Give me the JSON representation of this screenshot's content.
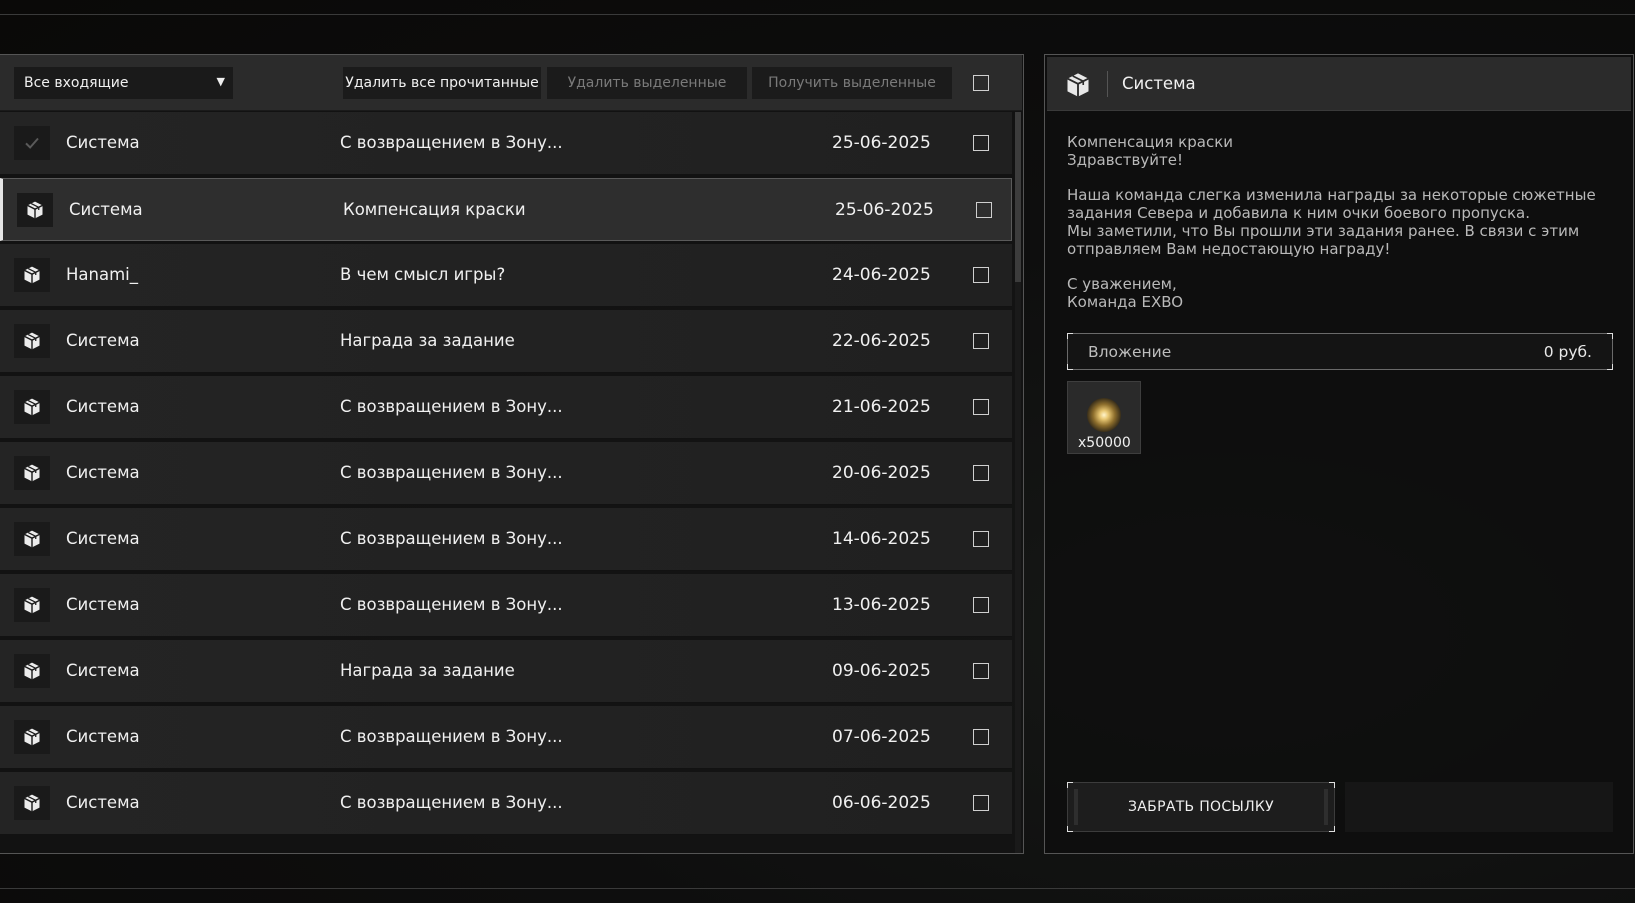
{
  "toolbar": {
    "filter_selected": "Все входящие",
    "delete_read_label": "Удалить все прочитанные",
    "delete_selected_label": "Удалить выделенные",
    "receive_selected_label": "Получить выделенные"
  },
  "mail_list": [
    {
      "sender": "Система",
      "subject": "С возвращением в Зону...",
      "date": "25-06-2025",
      "icon": "check-icon",
      "selected": false
    },
    {
      "sender": "Система",
      "subject": "Компенсация краски",
      "date": "25-06-2025",
      "icon": "package-icon",
      "selected": true
    },
    {
      "sender": "Hanami_",
      "subject": "В чем смысл игры?",
      "date": "24-06-2025",
      "icon": "package-icon",
      "selected": false
    },
    {
      "sender": "Система",
      "subject": "Награда за задание",
      "date": "22-06-2025",
      "icon": "package-icon",
      "selected": false
    },
    {
      "sender": "Система",
      "subject": "С возвращением в Зону...",
      "date": "21-06-2025",
      "icon": "package-icon",
      "selected": false
    },
    {
      "sender": "Система",
      "subject": "С возвращением в Зону...",
      "date": "20-06-2025",
      "icon": "package-icon",
      "selected": false
    },
    {
      "sender": "Система",
      "subject": "С возвращением в Зону...",
      "date": "14-06-2025",
      "icon": "package-icon",
      "selected": false
    },
    {
      "sender": "Система",
      "subject": "С возвращением в Зону...",
      "date": "13-06-2025",
      "icon": "package-icon",
      "selected": false
    },
    {
      "sender": "Система",
      "subject": "Награда за задание",
      "date": "09-06-2025",
      "icon": "package-icon",
      "selected": false
    },
    {
      "sender": "Система",
      "subject": "С возвращением в Зону...",
      "date": "07-06-2025",
      "icon": "package-icon",
      "selected": false
    },
    {
      "sender": "Система",
      "subject": "С возвращением в Зону...",
      "date": "06-06-2025",
      "icon": "package-icon",
      "selected": false
    }
  ],
  "detail": {
    "sender": "Система",
    "subject": "Компенсация краски",
    "greeting": "Здравствуйте!",
    "body_line1": "Наша команда слегка изменила награды за некоторые сюжетные",
    "body_line2": "задания Севера и добавила к ним очки боевого пропуска.",
    "body_line3": "Мы заметили, что Вы прошли эти задания ранее. В связи с этим",
    "body_line4": "отправляем Вам недостающую награду!",
    "sign1": "С уважением,",
    "sign2": "Команда EXBO",
    "attachment_label": "Вложение",
    "attachment_price": "0  руб.",
    "item_qty": "x50000",
    "item_icon": "glowing-orb-icon",
    "claim_label": "ЗАБРАТЬ ПОСЫЛКУ"
  },
  "colors": {
    "background": "#0e0e0e",
    "row_bg": "#222222",
    "row_selected_bg": "#2e2e2e",
    "text_primary": "#f0f0f0",
    "text_muted": "#b9b9b9",
    "disabled_text": "#7a7a7a"
  }
}
